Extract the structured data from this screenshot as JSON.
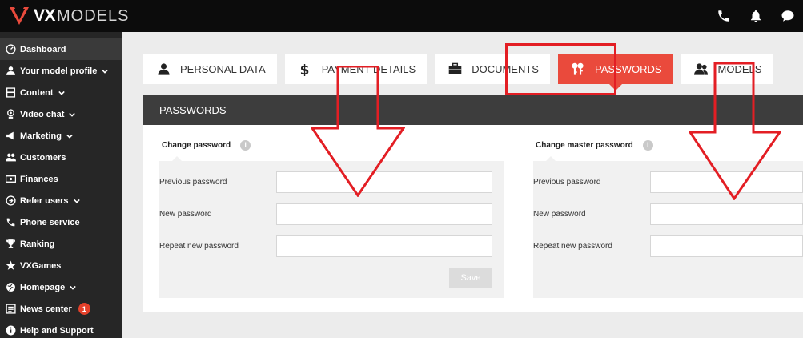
{
  "brand": {
    "bold": "VX",
    "light": "MODELS"
  },
  "colors": {
    "accent": "#ea4a3c",
    "topbar": "#0c0c0c",
    "sidebar": "#262626",
    "annotation": "#e31e24"
  },
  "topbar_icons": [
    "phone-icon",
    "bell-icon",
    "chat-icon"
  ],
  "sidebar": {
    "items": [
      {
        "label": "Dashboard",
        "icon": "dashboard-icon",
        "chevron": false
      },
      {
        "label": "Your model profile",
        "icon": "user-icon",
        "chevron": true
      },
      {
        "label": "Content",
        "icon": "film-icon",
        "chevron": true
      },
      {
        "label": "Video chat",
        "icon": "webcam-icon",
        "chevron": true
      },
      {
        "label": "Marketing",
        "icon": "megaphone-icon",
        "chevron": true
      },
      {
        "label": "Customers",
        "icon": "users-icon",
        "chevron": false
      },
      {
        "label": "Finances",
        "icon": "money-icon",
        "chevron": false
      },
      {
        "label": "Refer users",
        "icon": "refer-icon",
        "chevron": true
      },
      {
        "label": "Phone service",
        "icon": "phone-icon",
        "chevron": false
      },
      {
        "label": "Ranking",
        "icon": "trophy-icon",
        "chevron": false
      },
      {
        "label": "VXGames",
        "icon": "star-icon",
        "chevron": false
      },
      {
        "label": "Homepage",
        "icon": "globe-icon",
        "chevron": true
      },
      {
        "label": "News center",
        "icon": "news-icon",
        "chevron": false,
        "badge": "1"
      },
      {
        "label": "Help and Support",
        "icon": "info-icon",
        "chevron": false
      }
    ]
  },
  "tabs": [
    {
      "label": "PERSONAL DATA",
      "icon": "user-icon",
      "active": false
    },
    {
      "label": "PAYMENT DETAILS",
      "icon": "dollar-icon",
      "active": false
    },
    {
      "label": "DOCUMENTS",
      "icon": "briefcase-icon",
      "active": false
    },
    {
      "label": "PASSWORDS",
      "icon": "keys-icon",
      "active": true
    },
    {
      "label": "MODELS",
      "icon": "models-icon",
      "active": false
    }
  ],
  "card": {
    "title": "PASSWORDS",
    "left": {
      "title": "Change password",
      "previous": "Previous password",
      "new": "New password",
      "repeat": "Repeat new password",
      "save": "Save"
    },
    "right": {
      "title": "Change master password",
      "previous": "Previous password",
      "new": "New password",
      "repeat": "Repeat new password"
    },
    "info_glyph": "i"
  }
}
